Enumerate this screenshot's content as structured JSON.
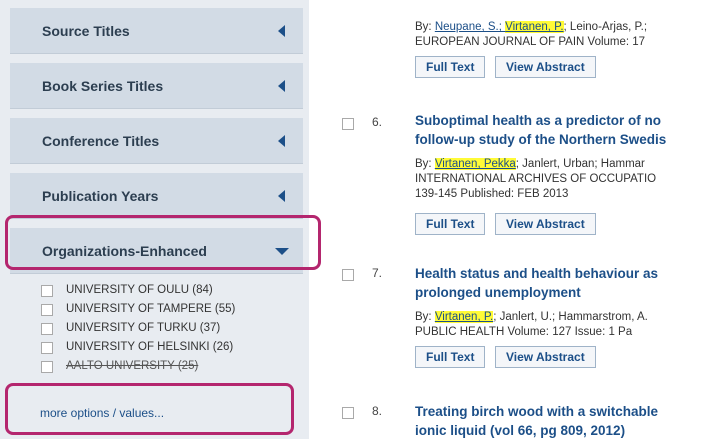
{
  "sidebar": {
    "facets": [
      {
        "label": "Source Titles",
        "state": "collapsed"
      },
      {
        "label": "Book Series Titles",
        "state": "collapsed"
      },
      {
        "label": "Conference Titles",
        "state": "collapsed"
      },
      {
        "label": "Publication Years",
        "state": "collapsed"
      },
      {
        "label": "Organizations-Enhanced",
        "state": "expanded"
      }
    ],
    "organizations": [
      {
        "label": "UNIVERSITY OF OULU (84)",
        "checked": false
      },
      {
        "label": "UNIVERSITY OF TAMPERE (55)",
        "checked": false
      },
      {
        "label": "UNIVERSITY OF TURKU (37)",
        "checked": false
      },
      {
        "label": "UNIVERSITY OF HELSINKI (26)",
        "checked": false
      },
      {
        "label": "AALTO UNIVERSITY (25)",
        "checked": false
      }
    ],
    "more_options": "more options / values...",
    "highlight_color": "#b4266e"
  },
  "results": {
    "top_clip": "...y...",
    "r5": {
      "by": "By: ",
      "author_hl": "Virtanen, P.",
      "authors_rest": "; Leino-Arjas, P.;",
      "authors_pre": "Neupane, S.; ",
      "source": "EUROPEAN JOURNAL OF PAIN  Volume: 17",
      "full_text": "Full Text",
      "view_abstract": "View Abstract"
    },
    "r6": {
      "number": "6.",
      "title_line1": "Suboptimal health as a predictor of no",
      "title_line2": "follow-up study of the Northern Swedis",
      "by": "By: ",
      "author_hl": "Virtanen, Pekka",
      "authors_rest": "; Janlert, Urban; Hammar",
      "source_line1": "INTERNATIONAL ARCHIVES OF OCCUPATIO",
      "source_line2": "139-145   Published: FEB 2013",
      "full_text": "Full Text",
      "view_abstract": "View Abstract"
    },
    "r7": {
      "number": "7.",
      "title_line1": "Health status and health behaviour as",
      "title_line2": "prolonged unemployment",
      "by": "By: ",
      "author_hl": "Virtanen, P.",
      "authors_rest": "; Janlert, U.; Hammarstrom, A.",
      "source": "PUBLIC HEALTH  Volume: 127   Issue: 1   Pa",
      "full_text": "Full Text",
      "view_abstract": "View Abstract"
    },
    "r8": {
      "number": "8.",
      "title_line1": "Treating birch wood with a switchable",
      "title_line2": "ionic liquid (vol 66, pg 809, 2012)"
    }
  },
  "colors": {
    "link": "#1c4f88",
    "sidebar_bg": "#e8ecf1",
    "facet_bg": "#d2dbe5",
    "author_highlight": "#fffb37"
  }
}
